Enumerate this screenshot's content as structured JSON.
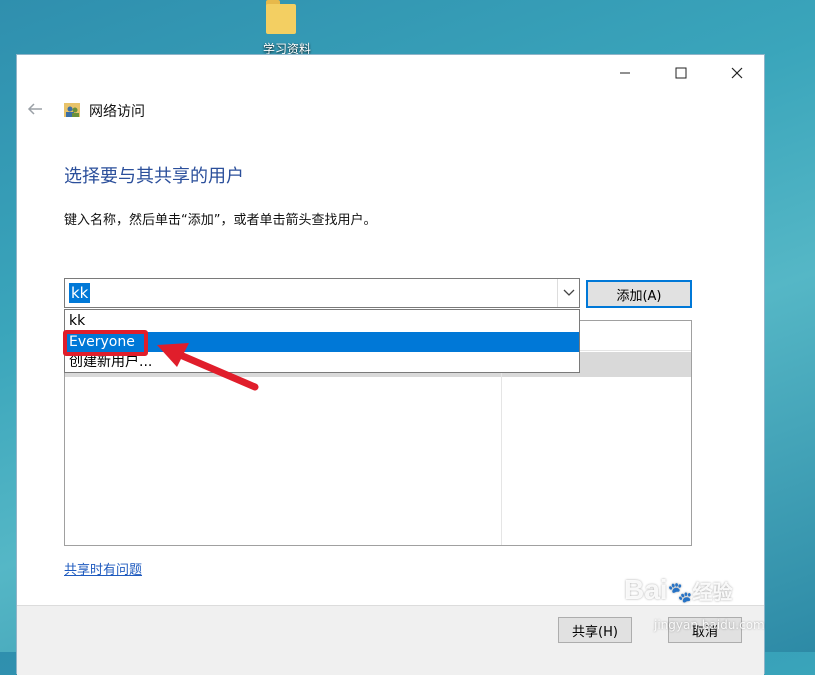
{
  "desktop": {
    "folder_label": "学习资料"
  },
  "window": {
    "title": "网络访问",
    "heading": "选择要与其共享的用户",
    "instruction": "键入名称，然后单击“添加”，或者单击箭头查找用户。",
    "combo_value": "kk",
    "add_button": "添加(A)",
    "dropdown_options": [
      "kk",
      "Everyone",
      "创建新用户..."
    ],
    "selected_option": "Everyone",
    "help_link": "共享时有问题",
    "share_button": "共享(H)",
    "cancel_button": "取消"
  },
  "watermark": {
    "logo_text": "Bai",
    "logo_text2": "经验",
    "url": "jingyan.baidu.com"
  },
  "colors": {
    "accent": "#0078d7",
    "highlight_red": "#e01e2b",
    "heading_blue": "#2b4f9b"
  }
}
